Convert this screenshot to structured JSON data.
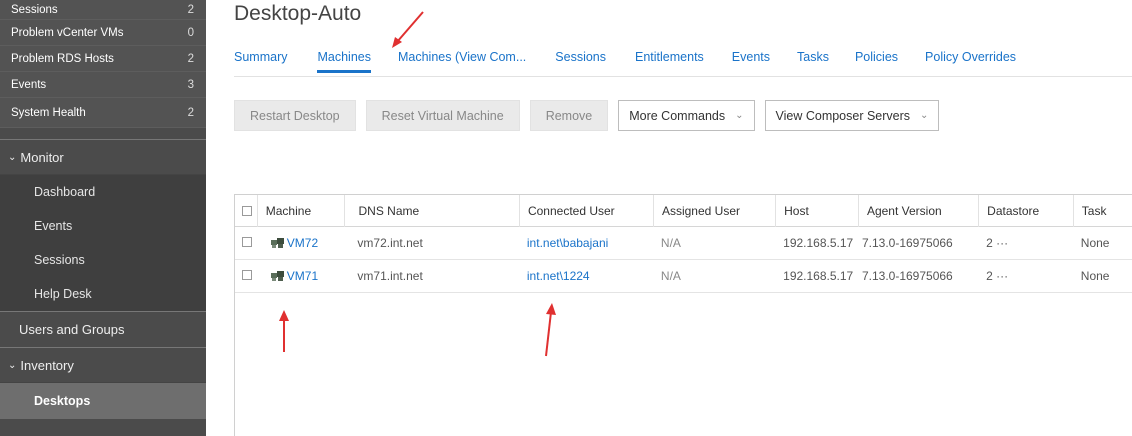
{
  "sidebar": {
    "stats": [
      {
        "label": "Sessions",
        "count": "2"
      },
      {
        "label": "Problem vCenter VMs",
        "count": "0"
      },
      {
        "label": "Problem RDS Hosts",
        "count": "2"
      },
      {
        "label": "Events",
        "count": "3"
      },
      {
        "label": "System Health",
        "count": "2"
      }
    ],
    "monitor": {
      "label": "Monitor",
      "items": [
        "Dashboard",
        "Events",
        "Sessions",
        "Help Desk"
      ]
    },
    "users_groups": "Users and Groups",
    "inventory": {
      "label": "Inventory",
      "active_item": "Desktops"
    }
  },
  "page": {
    "title": "Desktop-Auto",
    "tabs": [
      "Summary",
      "Machines",
      "Machines (View Com...",
      "Sessions",
      "Entitlements",
      "Events",
      "Tasks",
      "Policies",
      "Policy Overrides"
    ],
    "active_tab": "Machines"
  },
  "toolbar": {
    "restart": "Restart Desktop",
    "reset": "Reset Virtual Machine",
    "remove": "Remove",
    "more_commands": "More Commands",
    "view_composer": "View Composer Servers"
  },
  "table": {
    "headers": [
      "Machine",
      "DNS Name",
      "Connected User",
      "Assigned User",
      "Host",
      "Agent Version",
      "Datastore",
      "Task"
    ],
    "rows": [
      {
        "machine": "VM72",
        "dns": "vm72.int.net",
        "connected_user": "int.net\\babajani",
        "assigned_user": "N/A",
        "host": "192.168.5.17",
        "agent_version": "7.13.0-16975066",
        "datastore": "2 ···",
        "task": "None"
      },
      {
        "machine": "VM71",
        "dns": "vm71.int.net",
        "connected_user": "int.net\\1224",
        "assigned_user": "N/A",
        "host": "192.168.5.17",
        "agent_version": "7.13.0-16975066",
        "datastore": "2 ···",
        "task": "None"
      }
    ]
  },
  "colors": {
    "link": "#1a73c9",
    "annotation_arrow": "#e03030",
    "sidebar_bg": "#4b4b4b"
  },
  "icons": [
    "chevron-down-icon",
    "vm-icon",
    "checkbox-icon",
    "caret-down-icon",
    "red-arrow-annotation"
  ]
}
